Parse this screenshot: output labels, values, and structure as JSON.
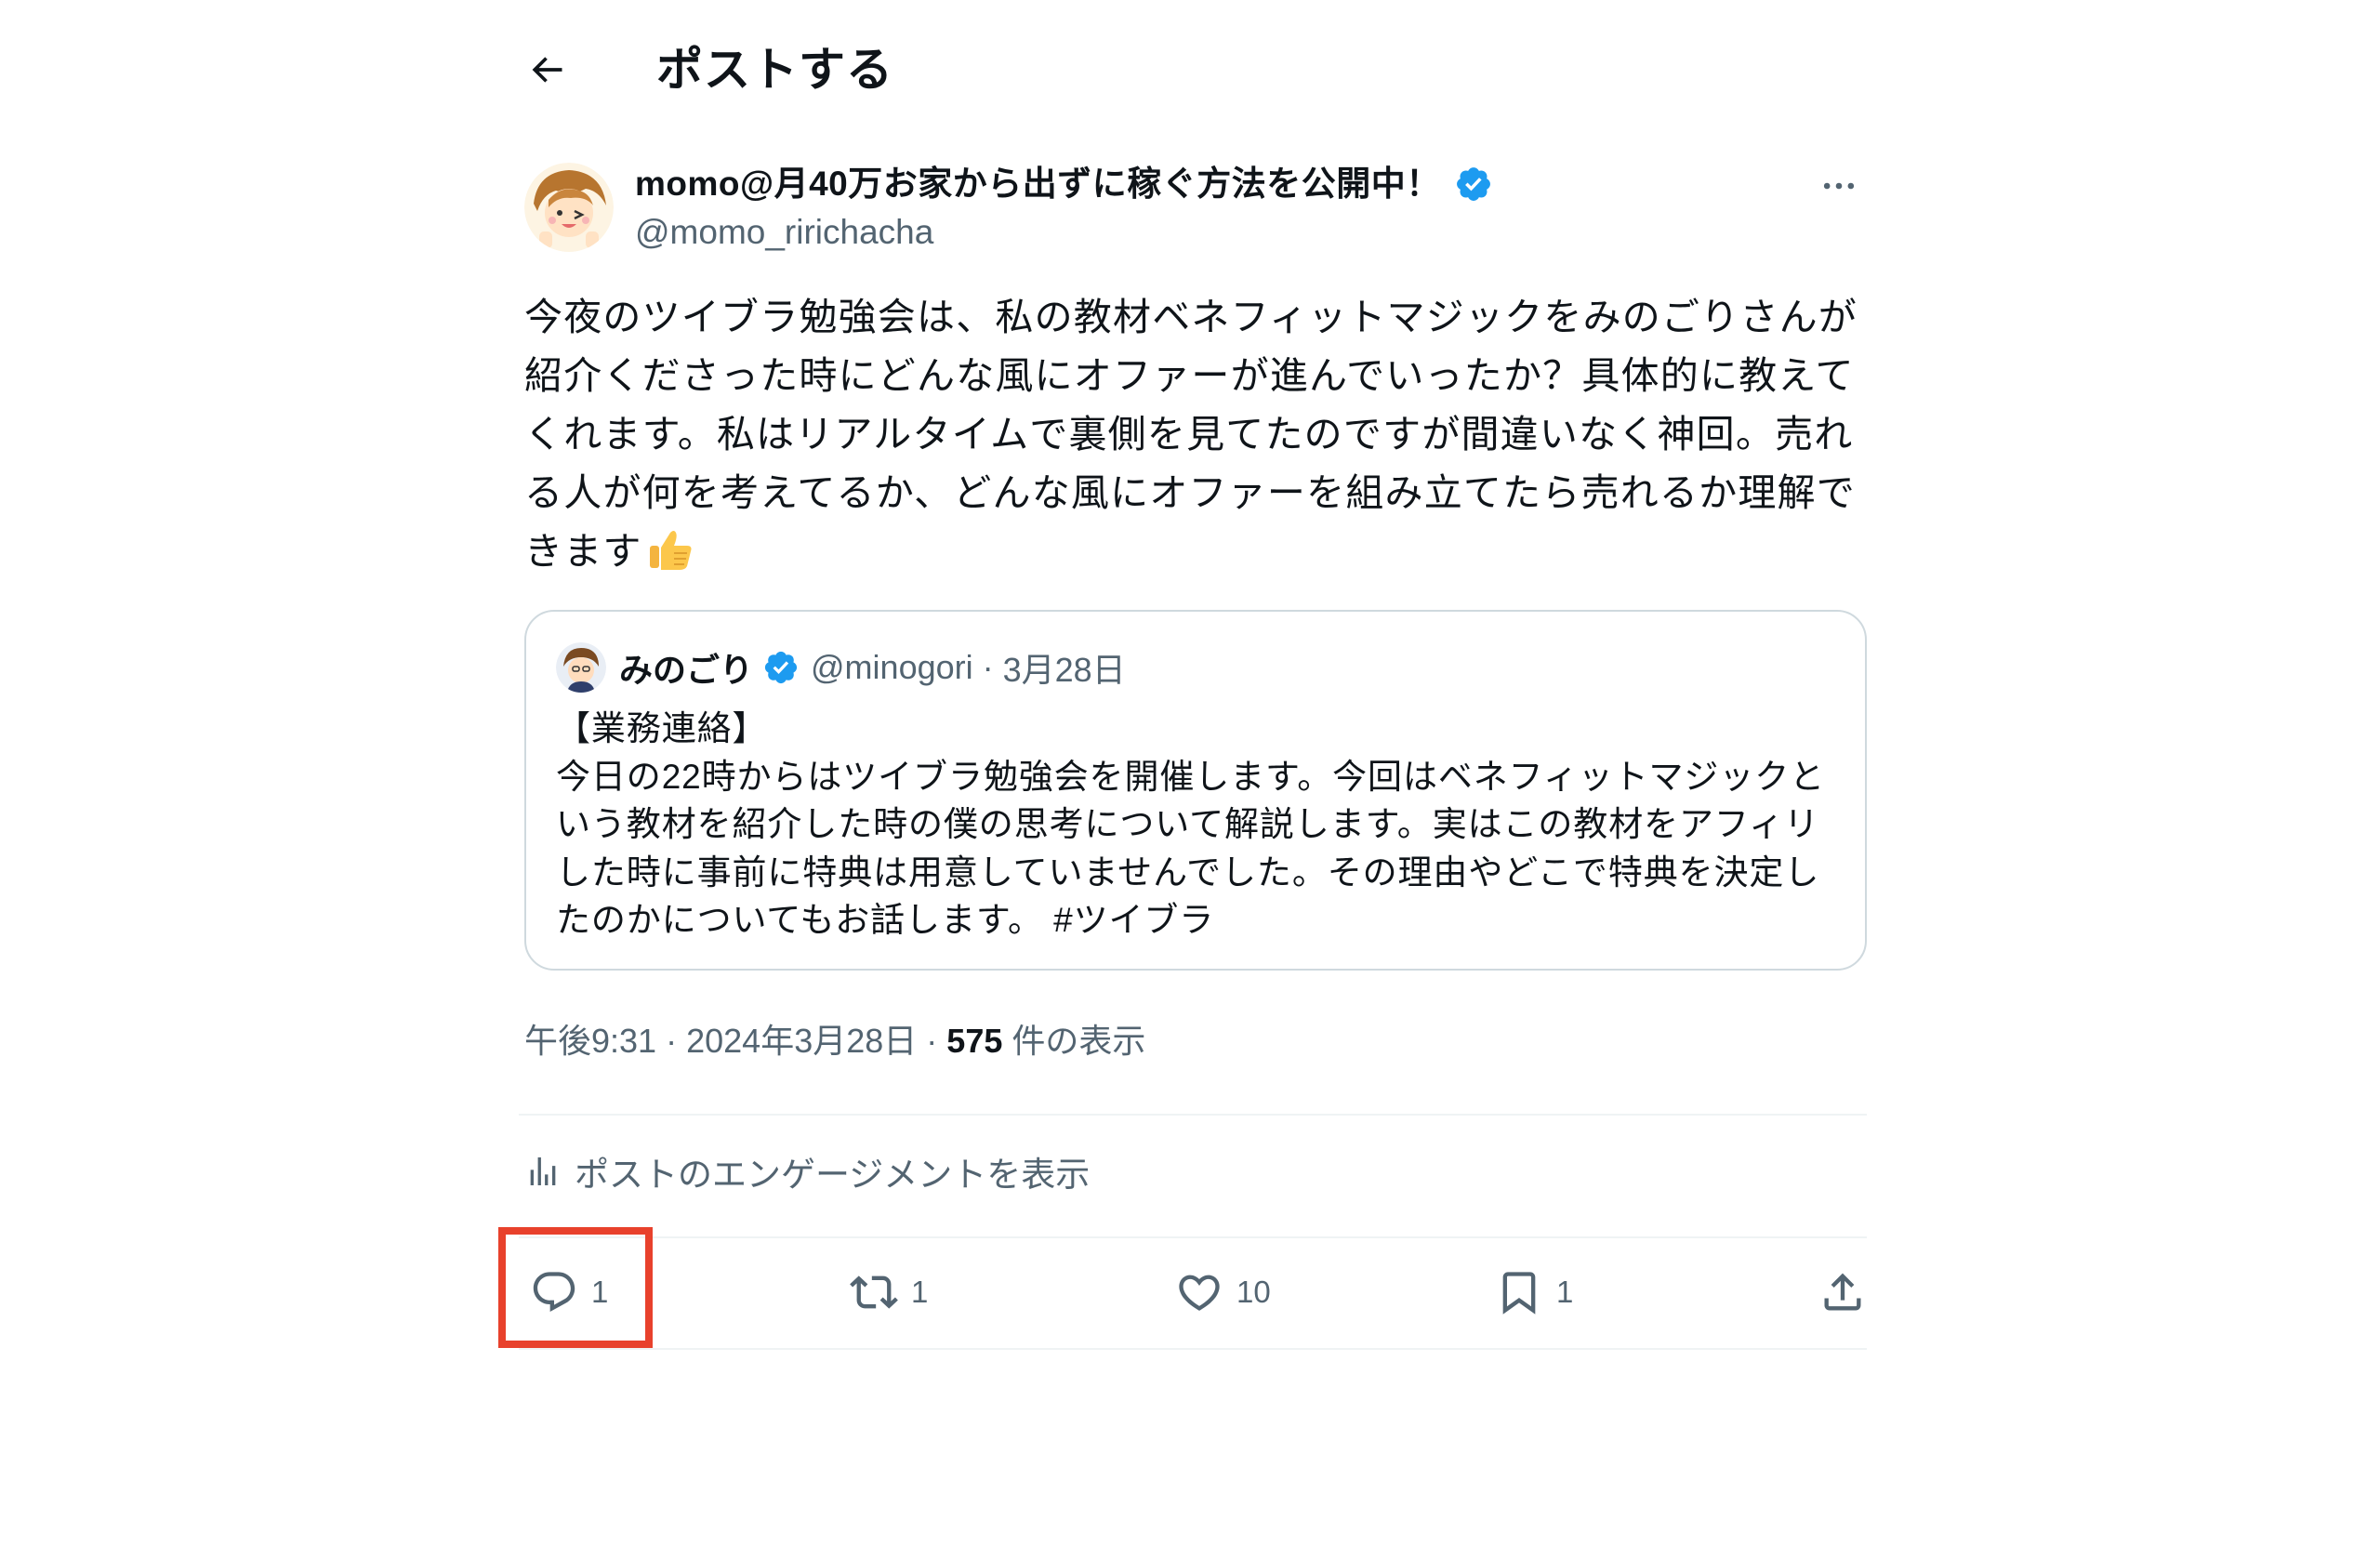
{
  "header": {
    "title": "ポストする",
    "back_icon": "arrow-left-icon"
  },
  "author": {
    "name": "momo@月40万お家から出ずに稼ぐ方法を公開中！",
    "handle": "@momo_ririchacha",
    "verified": true,
    "badge_color": "#1d9bf0"
  },
  "post": {
    "text": "今夜のツイブラ勉強会は、私の教材ベネフィットマジックをみのごりさんが紹介くださった時にどんな風にオファーが進んでいったか？具体的に教えてくれます。私はリアルタイムで裏側を見てたのですが間違いなく神回。売れる人が何を考えてるか、どんな風にオファーを組み立てたら売れるか理解できます",
    "emoji": "thumbs-up-icon"
  },
  "quote": {
    "name": "みのごり",
    "handle": "@minogori",
    "separator": "·",
    "date": "3月28日",
    "text": "【業務連絡】\n今日の22時からはツイブラ勉強会を開催します。今回はベネフィットマジックという教材を紹介した時の僕の思考について解説します。実はこの教材をアフィリした時に事前に特典は用意していませんでした。その理由やどこで特典を決定したのかについてもお話します。 #ツイブラ"
  },
  "meta": {
    "time": "午後9:31",
    "date": "2024年3月28日",
    "separator": "·",
    "views_count": "575",
    "views_label": "件の表示"
  },
  "engagement_link": "ポストのエンゲージメントを表示",
  "actions": {
    "reply_count": "1",
    "repost_count": "1",
    "like_count": "10",
    "bookmark_count": "1"
  },
  "highlight_color": "#e8412c"
}
